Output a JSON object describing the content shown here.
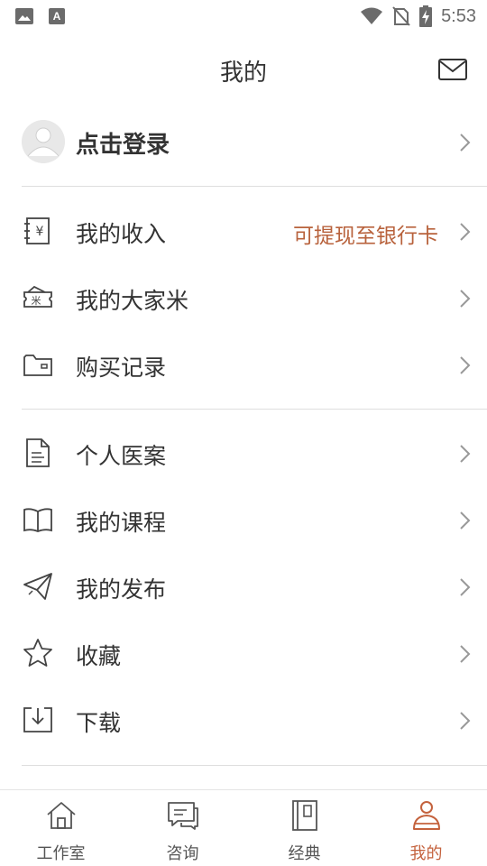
{
  "status_bar": {
    "time": "5:53",
    "icons": [
      "image-icon",
      "font-icon",
      "wifi-icon",
      "no-sim-icon",
      "battery-charging-icon"
    ]
  },
  "header": {
    "title": "我的",
    "mail_icon": "mail-icon"
  },
  "login": {
    "label": "点击登录",
    "avatar_icon": "default-avatar-icon"
  },
  "section1": [
    {
      "icon": "income-icon",
      "label": "我的收入",
      "extra": "可提现至银行卡"
    },
    {
      "icon": "ticket-icon",
      "label": "我的大家米"
    },
    {
      "icon": "wallet-icon",
      "label": "购买记录"
    }
  ],
  "section2": [
    {
      "icon": "document-icon",
      "label": "个人医案"
    },
    {
      "icon": "book-icon",
      "label": "我的课程"
    },
    {
      "icon": "send-icon",
      "label": "我的发布"
    },
    {
      "icon": "star-icon",
      "label": "收藏"
    },
    {
      "icon": "download-icon",
      "label": "下载"
    }
  ],
  "tabs": [
    {
      "icon": "home-icon",
      "label": "工作室"
    },
    {
      "icon": "chat-icon",
      "label": "咨询"
    },
    {
      "icon": "classic-book-icon",
      "label": "经典"
    },
    {
      "icon": "user-icon",
      "label": "我的",
      "active": true
    }
  ],
  "colors": {
    "accent": "#c4623d",
    "extra_text": "#b8623c",
    "divider": "#dedede",
    "text": "#333333"
  }
}
